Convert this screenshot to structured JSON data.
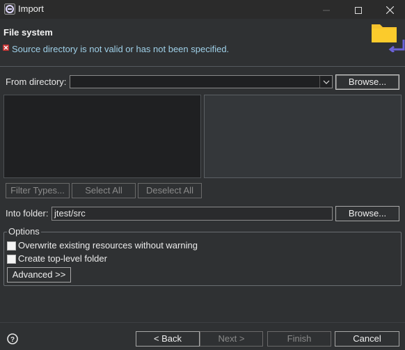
{
  "window": {
    "title": "Import",
    "minimize_icon": "minimize-icon",
    "maximize_icon": "maximize-icon",
    "close_icon": "close-icon"
  },
  "banner": {
    "title": "File system",
    "message": "Source directory is not valid or has not been specified.",
    "message_color": "#9fd0e8",
    "error_icon": "error-icon",
    "graphic_icon": "folder-import-icon"
  },
  "source": {
    "from_label": "From directory:",
    "from_value": "",
    "browse_label": "Browse..."
  },
  "selection_buttons": {
    "filter_types": "Filter Types...",
    "select_all": "Select All",
    "deselect_all": "Deselect All"
  },
  "destination": {
    "into_label": "Into folder:",
    "into_value": "jtest/src",
    "browse_label": "Browse..."
  },
  "options": {
    "group_label": "Options",
    "overwrite_label": "Overwrite existing resources without warning",
    "overwrite_checked": false,
    "toplevel_label": "Create top-level folder",
    "toplevel_checked": false,
    "advanced_label": "Advanced >>"
  },
  "footer": {
    "help_icon": "help-icon",
    "back_label": "< Back",
    "next_label": "Next >",
    "finish_label": "Finish",
    "cancel_label": "Cancel"
  }
}
